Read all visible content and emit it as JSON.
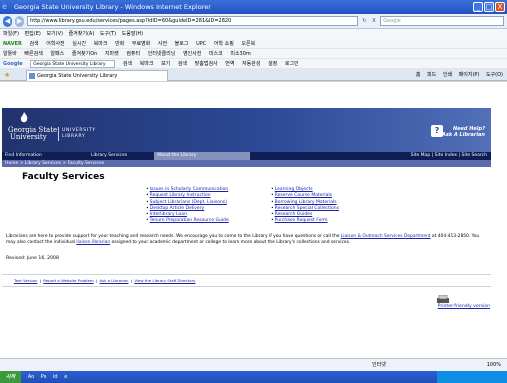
{
  "window": {
    "title": "Georgia State University Library - Windows Internet Explorer",
    "minimize": "_",
    "maximize": "□",
    "close": "X"
  },
  "addressbar": {
    "back": "◀",
    "forward": "▶",
    "url": "http://www.library.gsu.edu/services/pages.asp?ldID=60&guideID=281&ID=2820",
    "refresh": "↻",
    "stop": "X",
    "search_placeholder": "Google"
  },
  "menubar": {
    "items": [
      "파일(F)",
      "편집(E)",
      "보기(V)",
      "즐겨찾기(A)",
      "도구(T)",
      "도움말(H)"
    ]
  },
  "toolbars": {
    "row1": [
      "NAVER",
      "검색",
      "어학사전",
      "실시간",
      "북마크",
      "만화",
      "무료영화",
      "사전",
      "블로그",
      "UPC",
      "어학 쇼핑",
      "오픈북"
    ],
    "row2": [
      "알툴바",
      "빠른검색",
      "알패스",
      "즐겨찾기On",
      "지마켓",
      "컴퓨터",
      "인터넷클리닝",
      "영인사전",
      "미스코",
      "미소30m"
    ],
    "row3": [
      "Google",
      "Georgia State University Library",
      "검색",
      "북마크",
      "보기",
      "검색",
      "맞춤법검사",
      "번역",
      "자동완성",
      "설정",
      "로그인"
    ]
  },
  "tabs": {
    "active_tab": "Georgia State University Library",
    "tools": [
      "홈",
      "피드",
      "인쇄",
      "페이지(P)",
      "도구(O)"
    ]
  },
  "site": {
    "logo_line1": "Georgia State",
    "logo_line2": "University",
    "logo_line3a": "UNIVERSITY",
    "logo_line3b": "LIBRARY",
    "help_line1": "Need Help?",
    "help_line2": "Ask A Librarian",
    "nav": {
      "find": "Find Information",
      "services": "Library Services",
      "about": "About the Library",
      "sitemap": "Site Map",
      "siteindex": "Site Index",
      "sitesearch": "Site Search",
      "sep": "|"
    },
    "breadcrumb": "Home > Library Services > Faculty Services",
    "page_title": "Faculty Services",
    "links_col1": [
      "Issues in Scholarly Communication",
      "Request Library Instruction",
      "Subject Librarians (Dept. Liaisons)",
      "Desktop Article Delivery",
      "Interlibrary Loan",
      "Tenure Preparation Resource Guide"
    ],
    "links_col2": [
      "Learning Objects",
      "Reserve Course Materials",
      "Borrowing Library Materials",
      "Research Special Collections",
      "Research Guides",
      "Purchase Request Form"
    ],
    "para_a": "Librarians are here to provide support for your teaching and research needs. We encourage you to come to the Library if you have questions or call the ",
    "para_link1": "Liaison & Outreach Services Department",
    "para_b": " at 404-413-2850. You may also contact the individual ",
    "para_link2": "liaison librarian",
    "para_c": " assigned to your academic department or college to learn more about the Library's collections and services.",
    "revised": "Revised: June 16, 2008",
    "footer": [
      "Text Version",
      "Report a Website Problem",
      "Ask a Librarian",
      "View the Library Staff Directory"
    ],
    "footer_sep": "|",
    "printer": "Printer-friendly version"
  },
  "statusbar": {
    "zone": "인터넷",
    "zoom": "100%"
  },
  "taskbar": {
    "start": "시작",
    "items": [
      "Ao",
      "Ps",
      "Id",
      "e"
    ]
  },
  "colors": {
    "header_dark": "#22336e",
    "nav_bg": "#0f1f55",
    "link": "#1a23a8"
  }
}
